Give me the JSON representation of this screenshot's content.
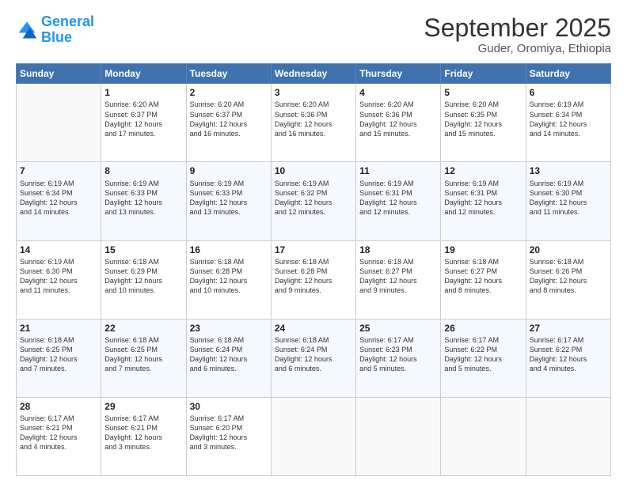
{
  "logo": {
    "line1": "General",
    "line2": "Blue"
  },
  "header": {
    "month": "September 2025",
    "location": "Guder, Oromiya, Ethiopia"
  },
  "days_of_week": [
    "Sunday",
    "Monday",
    "Tuesday",
    "Wednesday",
    "Thursday",
    "Friday",
    "Saturday"
  ],
  "weeks": [
    [
      {
        "num": "",
        "info": ""
      },
      {
        "num": "1",
        "info": "Sunrise: 6:20 AM\nSunset: 6:37 PM\nDaylight: 12 hours\nand 17 minutes."
      },
      {
        "num": "2",
        "info": "Sunrise: 6:20 AM\nSunset: 6:37 PM\nDaylight: 12 hours\nand 16 minutes."
      },
      {
        "num": "3",
        "info": "Sunrise: 6:20 AM\nSunset: 6:36 PM\nDaylight: 12 hours\nand 16 minutes."
      },
      {
        "num": "4",
        "info": "Sunrise: 6:20 AM\nSunset: 6:36 PM\nDaylight: 12 hours\nand 15 minutes."
      },
      {
        "num": "5",
        "info": "Sunrise: 6:20 AM\nSunset: 6:35 PM\nDaylight: 12 hours\nand 15 minutes."
      },
      {
        "num": "6",
        "info": "Sunrise: 6:19 AM\nSunset: 6:34 PM\nDaylight: 12 hours\nand 14 minutes."
      }
    ],
    [
      {
        "num": "7",
        "info": "Sunrise: 6:19 AM\nSunset: 6:34 PM\nDaylight: 12 hours\nand 14 minutes."
      },
      {
        "num": "8",
        "info": "Sunrise: 6:19 AM\nSunset: 6:33 PM\nDaylight: 12 hours\nand 13 minutes."
      },
      {
        "num": "9",
        "info": "Sunrise: 6:19 AM\nSunset: 6:33 PM\nDaylight: 12 hours\nand 13 minutes."
      },
      {
        "num": "10",
        "info": "Sunrise: 6:19 AM\nSunset: 6:32 PM\nDaylight: 12 hours\nand 12 minutes."
      },
      {
        "num": "11",
        "info": "Sunrise: 6:19 AM\nSunset: 6:31 PM\nDaylight: 12 hours\nand 12 minutes."
      },
      {
        "num": "12",
        "info": "Sunrise: 6:19 AM\nSunset: 6:31 PM\nDaylight: 12 hours\nand 12 minutes."
      },
      {
        "num": "13",
        "info": "Sunrise: 6:19 AM\nSunset: 6:30 PM\nDaylight: 12 hours\nand 11 minutes."
      }
    ],
    [
      {
        "num": "14",
        "info": "Sunrise: 6:19 AM\nSunset: 6:30 PM\nDaylight: 12 hours\nand 11 minutes."
      },
      {
        "num": "15",
        "info": "Sunrise: 6:18 AM\nSunset: 6:29 PM\nDaylight: 12 hours\nand 10 minutes."
      },
      {
        "num": "16",
        "info": "Sunrise: 6:18 AM\nSunset: 6:28 PM\nDaylight: 12 hours\nand 10 minutes."
      },
      {
        "num": "17",
        "info": "Sunrise: 6:18 AM\nSunset: 6:28 PM\nDaylight: 12 hours\nand 9 minutes."
      },
      {
        "num": "18",
        "info": "Sunrise: 6:18 AM\nSunset: 6:27 PM\nDaylight: 12 hours\nand 9 minutes."
      },
      {
        "num": "19",
        "info": "Sunrise: 6:18 AM\nSunset: 6:27 PM\nDaylight: 12 hours\nand 8 minutes."
      },
      {
        "num": "20",
        "info": "Sunrise: 6:18 AM\nSunset: 6:26 PM\nDaylight: 12 hours\nand 8 minutes."
      }
    ],
    [
      {
        "num": "21",
        "info": "Sunrise: 6:18 AM\nSunset: 6:25 PM\nDaylight: 12 hours\nand 7 minutes."
      },
      {
        "num": "22",
        "info": "Sunrise: 6:18 AM\nSunset: 6:25 PM\nDaylight: 12 hours\nand 7 minutes."
      },
      {
        "num": "23",
        "info": "Sunrise: 6:18 AM\nSunset: 6:24 PM\nDaylight: 12 hours\nand 6 minutes."
      },
      {
        "num": "24",
        "info": "Sunrise: 6:18 AM\nSunset: 6:24 PM\nDaylight: 12 hours\nand 6 minutes."
      },
      {
        "num": "25",
        "info": "Sunrise: 6:17 AM\nSunset: 6:23 PM\nDaylight: 12 hours\nand 5 minutes."
      },
      {
        "num": "26",
        "info": "Sunrise: 6:17 AM\nSunset: 6:22 PM\nDaylight: 12 hours\nand 5 minutes."
      },
      {
        "num": "27",
        "info": "Sunrise: 6:17 AM\nSunset: 6:22 PM\nDaylight: 12 hours\nand 4 minutes."
      }
    ],
    [
      {
        "num": "28",
        "info": "Sunrise: 6:17 AM\nSunset: 6:21 PM\nDaylight: 12 hours\nand 4 minutes."
      },
      {
        "num": "29",
        "info": "Sunrise: 6:17 AM\nSunset: 6:21 PM\nDaylight: 12 hours\nand 3 minutes."
      },
      {
        "num": "30",
        "info": "Sunrise: 6:17 AM\nSunset: 6:20 PM\nDaylight: 12 hours\nand 3 minutes."
      },
      {
        "num": "",
        "info": ""
      },
      {
        "num": "",
        "info": ""
      },
      {
        "num": "",
        "info": ""
      },
      {
        "num": "",
        "info": ""
      }
    ]
  ]
}
